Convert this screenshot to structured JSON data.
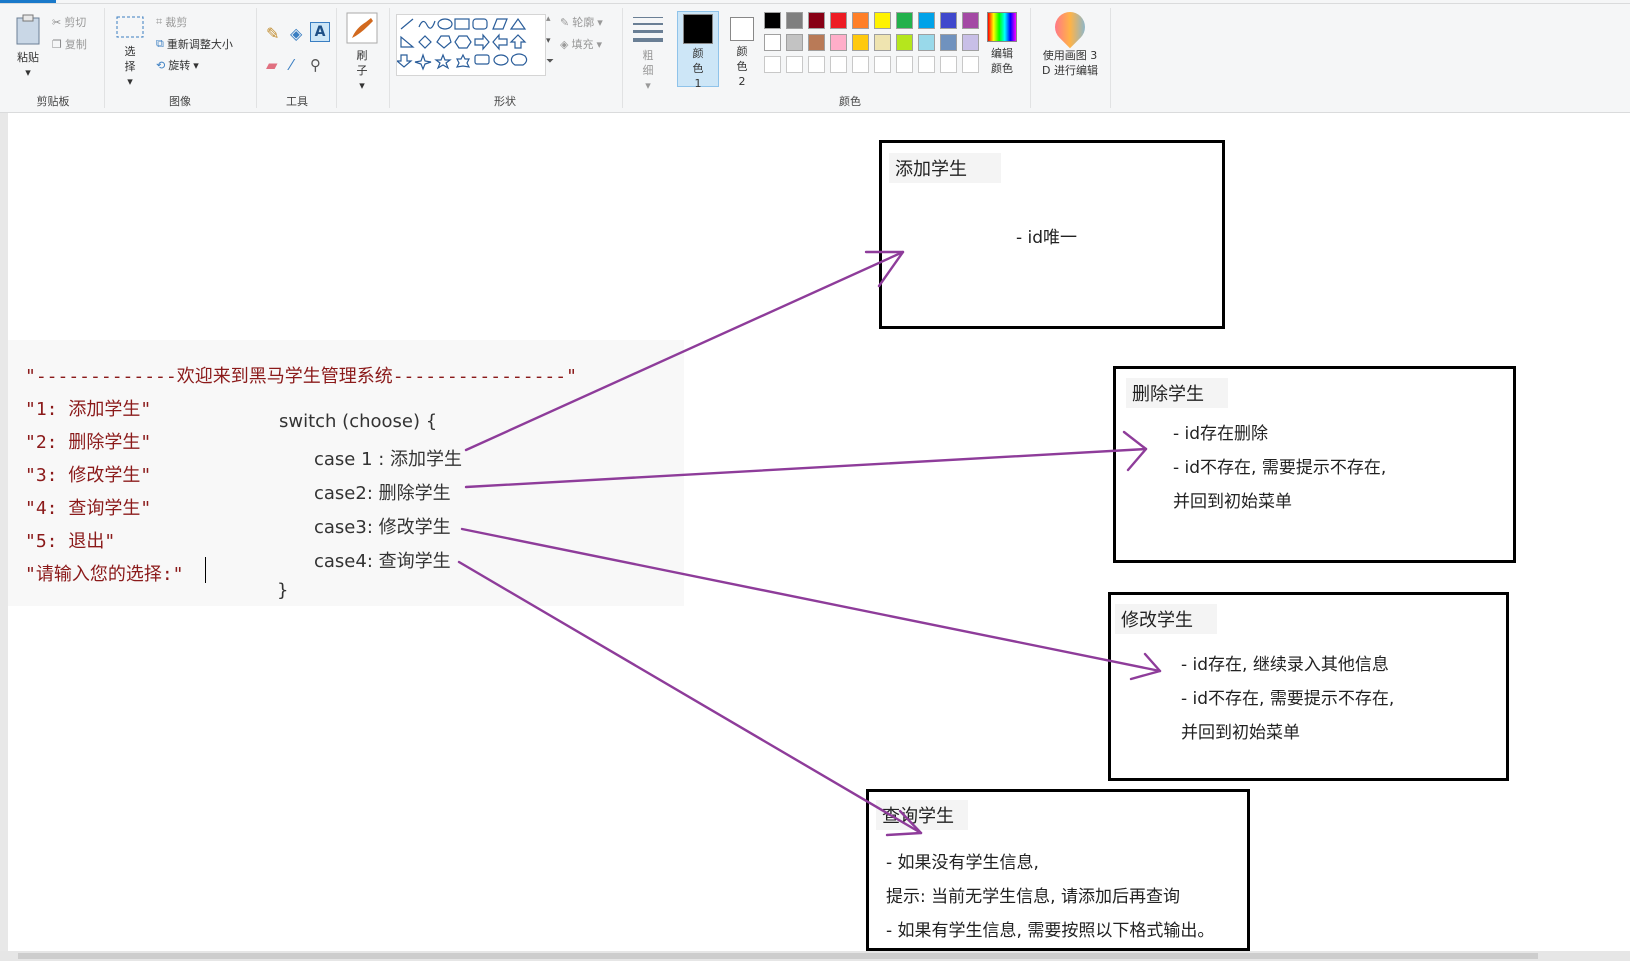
{
  "ribbon": {
    "clipboard": {
      "paste": "粘贴",
      "cut": "剪切",
      "copy": "复制",
      "group": "剪贴板"
    },
    "image": {
      "select": "选择",
      "crop": "裁剪",
      "resize": "重新调整大小",
      "rotate": "旋转",
      "group": "图像"
    },
    "tools": {
      "group": "工具"
    },
    "brushes": {
      "label": "刷子"
    },
    "shapes": {
      "outline": "轮廓",
      "fill": "填充",
      "group": "形状"
    },
    "size": {
      "label": "粗细"
    },
    "colors": {
      "color1": "颜色 1",
      "color2": "颜色 2",
      "edit": "编辑颜色",
      "group": "颜色",
      "row1": [
        "#000000",
        "#7f7f7f",
        "#880015",
        "#ed1c24",
        "#ff7f27",
        "#fff200",
        "#22b14c",
        "#00a2e8",
        "#3f48cc",
        "#a349a4"
      ],
      "row2": [
        "#ffffff",
        "#c3c3c3",
        "#b97a57",
        "#ffaec9",
        "#ffc90e",
        "#efe4b0",
        "#b5e61d",
        "#99d9ea",
        "#7092be",
        "#c8bfe7"
      ]
    },
    "paint3d": {
      "label_line1": "使用画图 3",
      "label_line2": "D 进行编辑"
    }
  },
  "menu": {
    "line0": "\"-------------欢迎来到黑马学生管理系统----------------\"",
    "line1": "\"1: 添加学生\"",
    "line2": "\"2: 删除学生\"",
    "line3": "\"3: 修改学生\"",
    "line4": "\"4: 查询学生\"",
    "line5": "\"5: 退出\"",
    "line6": "\"请输入您的选择:\""
  },
  "code": {
    "switch": "switch (choose) {",
    "case1": "case 1 : 添加学生",
    "case2": "case2:  删除学生",
    "case3": "case3: 修改学生",
    "case4": "case4: 查询学生",
    "close": "}"
  },
  "boxes": {
    "add": {
      "title": "添加学生",
      "line1": "- id唯一"
    },
    "delete": {
      "title": "删除学生",
      "line1": "- id存在删除",
      "line2": "- id不存在, 需要提示不存在,",
      "line3": "并回到初始菜单"
    },
    "modify": {
      "title": "修改学生",
      "line1": "- id存在, 继续录入其他信息",
      "line2": "- id不存在, 需要提示不存在,",
      "line3": "并回到初始菜单"
    },
    "query": {
      "title": "查询学生",
      "line1": "- 如果没有学生信息,",
      "line2": "提示: 当前无学生信息, 请添加后再查询",
      "line3": "- 如果有学生信息, 需要按照以下格式输出。"
    }
  },
  "arrow_color": "#8e3c9a"
}
